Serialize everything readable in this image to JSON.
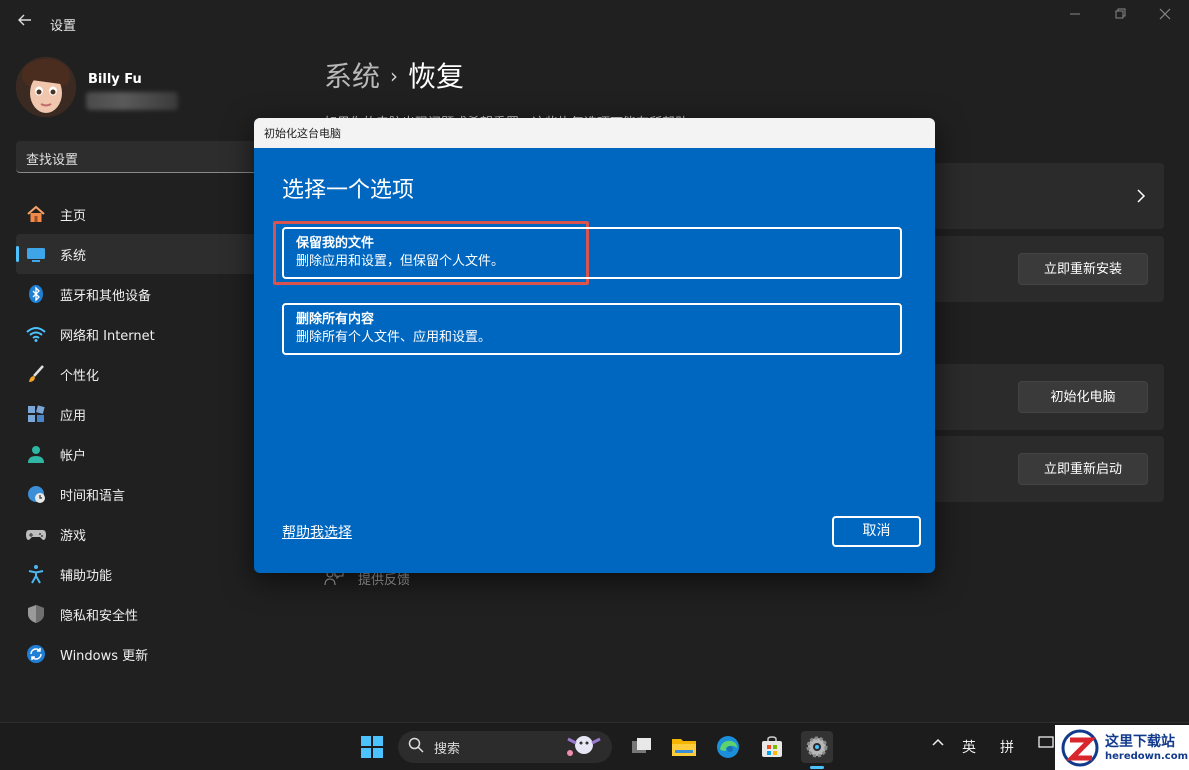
{
  "window": {
    "title": "设置"
  },
  "user": {
    "name": "Billy Fu"
  },
  "search": {
    "placeholder": "查找设置"
  },
  "nav": {
    "items": [
      {
        "label": "主页"
      },
      {
        "label": "系统"
      },
      {
        "label": "蓝牙和其他设备"
      },
      {
        "label": "网络和 Internet"
      },
      {
        "label": "个性化"
      },
      {
        "label": "应用"
      },
      {
        "label": "帐户"
      },
      {
        "label": "时间和语言"
      },
      {
        "label": "游戏"
      },
      {
        "label": "辅助功能"
      },
      {
        "label": "隐私和安全性"
      },
      {
        "label": "Windows 更新"
      }
    ]
  },
  "main": {
    "breadcrumb_parent": "系统",
    "breadcrumb_separator": "›",
    "breadcrumb_current": "恢复",
    "description": "如果你的电脑出现问题或希望重置，这些恢复选项可能有所帮助",
    "reinstall_button": "立即重新安装",
    "reset_button": "初始化电脑",
    "restart_button": "立即重新启动",
    "feedback_label": "提供反馈"
  },
  "dialog": {
    "title": "初始化这台电脑",
    "heading": "选择一个选项",
    "option_keep": {
      "title": "保留我的文件",
      "desc": "删除应用和设置，但保留个人文件。"
    },
    "option_remove": {
      "title": "删除所有内容",
      "desc": "删除所有个人文件、应用和设置。"
    },
    "help_link": "帮助我选择",
    "cancel_button": "取消"
  },
  "taskbar": {
    "search_label": "搜索",
    "ime_lang": "英",
    "ime_mode": "拼"
  },
  "watermark": {
    "cn": "这里下载站",
    "en": "heredown.com"
  },
  "colors": {
    "dialog_bg": "#0067c0",
    "accent": "#4cc2ff",
    "highlight": "#d9534f",
    "app_bg": "#202020"
  }
}
